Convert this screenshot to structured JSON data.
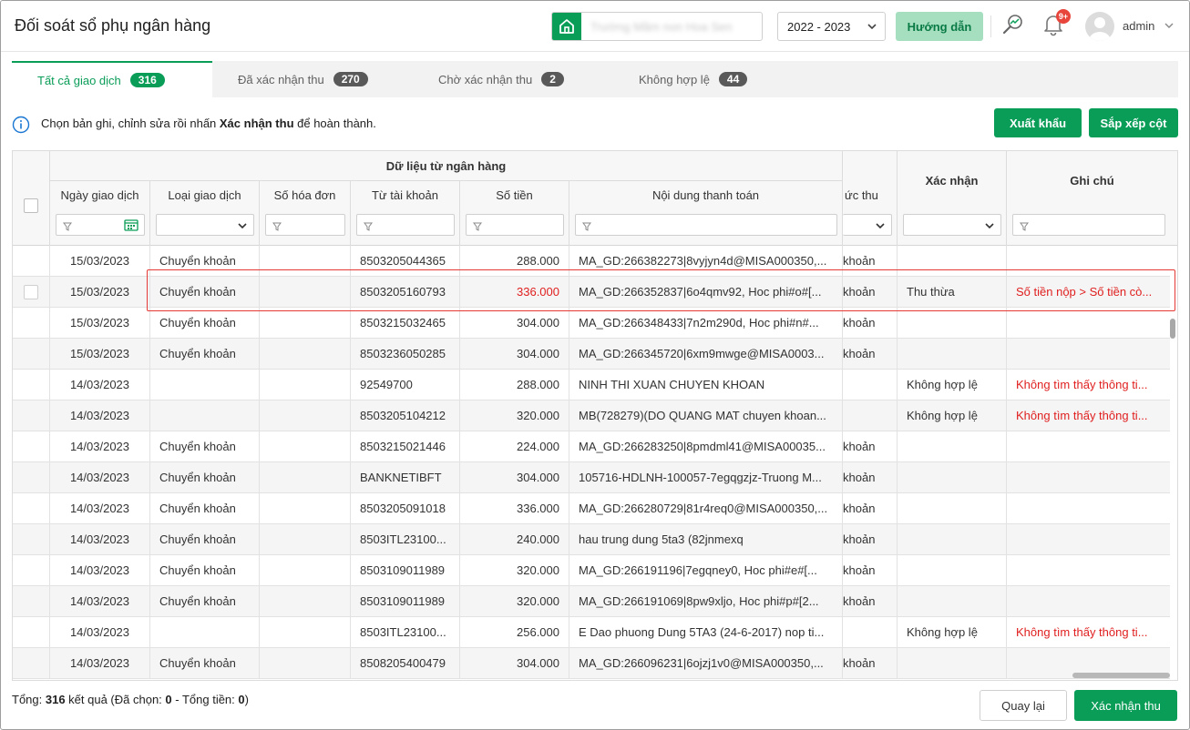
{
  "header": {
    "title": "Đối soát sổ phụ ngân hàng",
    "school_name": "Trường Mầm non Hoa Sen",
    "year": "2022 - 2023",
    "guide_label": "Hướng dẫn",
    "notification_badge": "9+",
    "user_name": "admin"
  },
  "tabs": [
    {
      "label": "Tất cả giao dịch",
      "count": "316"
    },
    {
      "label": "Đã xác nhận thu",
      "count": "270"
    },
    {
      "label": "Chờ xác nhận thu",
      "count": "2"
    },
    {
      "label": "Không hợp lệ",
      "count": "44"
    }
  ],
  "info": {
    "prefix": "Chọn bản ghi, chỉnh sửa rồi nhấn ",
    "bold": "Xác nhận thu",
    "suffix": " để hoàn thành."
  },
  "toolbar": {
    "export_label": "Xuất khẩu",
    "sort_label": "Sắp xếp cột"
  },
  "grid": {
    "group_title": "Dữ liệu từ ngân hàng",
    "columns": {
      "date": "Ngày giao dịch",
      "type": "Loại giao dịch",
      "invoice": "Số hóa đơn",
      "account": "Từ tài khoản",
      "amount": "Số tiền",
      "content": "Nội dung thanh toán",
      "method": "ức thu",
      "confirm": "Xác nhận",
      "note": "Ghi chú"
    },
    "rows": [
      {
        "date": "15/03/2023",
        "type": "Chuyển khoản",
        "invoice": "",
        "account": "8503205044365",
        "amount": "288.000",
        "content": "MA_GD:266382273|8vyjyn4d@MISA000350,...",
        "method": "khoản",
        "confirm": "",
        "note": ""
      },
      {
        "date": "15/03/2023",
        "type": "Chuyển khoản",
        "invoice": "",
        "account": "8503205160793",
        "amount": "336.000",
        "amount_red": true,
        "content": "MA_GD:266352837|6o4qmv92, Hoc phi#o#[...",
        "method": "khoản",
        "confirm": "Thu thừa",
        "note": "Số tiền nộp > Số tiền cò..."
      },
      {
        "date": "15/03/2023",
        "type": "Chuyển khoản",
        "invoice": "",
        "account": "8503215032465",
        "amount": "304.000",
        "content": "MA_GD:266348433|7n2m290d, Hoc phi#n#...",
        "method": "khoản",
        "confirm": "",
        "note": ""
      },
      {
        "date": "15/03/2023",
        "type": "Chuyển khoản",
        "invoice": "",
        "account": "8503236050285",
        "amount": "304.000",
        "content": "MA_GD:266345720|6xm9mwge@MISA0003...",
        "method": "khoản",
        "confirm": "",
        "note": ""
      },
      {
        "date": "14/03/2023",
        "type": "",
        "invoice": "",
        "account": "92549700",
        "amount": "288.000",
        "content": "NINH THI XUAN CHUYEN KHOAN",
        "method": "",
        "confirm": "Không hợp lệ",
        "note": "Không tìm thấy thông ti..."
      },
      {
        "date": "14/03/2023",
        "type": "",
        "invoice": "",
        "account": "8503205104212",
        "amount": "320.000",
        "content": "MB(728279)(DO QUANG MAT chuyen khoan...",
        "method": "",
        "confirm": "Không hợp lệ",
        "note": "Không tìm thấy thông ti..."
      },
      {
        "date": "14/03/2023",
        "type": "Chuyển khoản",
        "invoice": "",
        "account": "8503215021446",
        "amount": "224.000",
        "content": "MA_GD:266283250|8pmdml41@MISA00035...",
        "method": "khoản",
        "confirm": "",
        "note": ""
      },
      {
        "date": "14/03/2023",
        "type": "Chuyển khoản",
        "invoice": "",
        "account": "BANKNETIBFT",
        "amount": "304.000",
        "content": "105716-HDLNH-100057-7egqgzjz-Truong M...",
        "method": "khoản",
        "confirm": "",
        "note": ""
      },
      {
        "date": "14/03/2023",
        "type": "Chuyển khoản",
        "invoice": "",
        "account": "8503205091018",
        "amount": "336.000",
        "content": "MA_GD:266280729|81r4req0@MISA000350,...",
        "method": "khoản",
        "confirm": "",
        "note": ""
      },
      {
        "date": "14/03/2023",
        "type": "Chuyển khoản",
        "invoice": "",
        "account": "8503ITL23100...",
        "amount": "240.000",
        "content": "hau trung dung 5ta3 (82jnmexq",
        "method": "khoản",
        "confirm": "",
        "note": ""
      },
      {
        "date": "14/03/2023",
        "type": "Chuyển khoản",
        "invoice": "",
        "account": "8503109011989",
        "amount": "320.000",
        "content": "MA_GD:266191196|7egqney0, Hoc phi#e#[...",
        "method": "khoản",
        "confirm": "",
        "note": ""
      },
      {
        "date": "14/03/2023",
        "type": "Chuyển khoản",
        "invoice": "",
        "account": "8503109011989",
        "amount": "320.000",
        "content": "MA_GD:266191069|8pw9xljo, Hoc phi#p#[2...",
        "method": "khoản",
        "confirm": "",
        "note": ""
      },
      {
        "date": "14/03/2023",
        "type": "",
        "invoice": "",
        "account": "8503ITL23100...",
        "amount": "256.000",
        "content": "E Dao phuong Dung 5TA3 (24-6-2017) nop ti...",
        "method": "",
        "confirm": "Không hợp lệ",
        "note": "Không tìm thấy thông ti..."
      },
      {
        "date": "14/03/2023",
        "type": "Chuyển khoản",
        "invoice": "",
        "account": "8508205400479",
        "amount": "304.000",
        "content": "MA_GD:266096231|6ojzj1v0@MISA000350,...",
        "method": "khoản",
        "confirm": "",
        "note": ""
      }
    ]
  },
  "footer": {
    "total_label": "Tổng: ",
    "total_count": "316",
    "mid_label": " kết quả (Đã chọn: ",
    "selected_count": "0",
    "sum_label": " - Tổng tiền: ",
    "sum_value": "0",
    "close_paren": ")",
    "back_label": "Quay lại",
    "confirm_label": "Xác nhận thu"
  },
  "colors": {
    "accent": "#0a9d58",
    "error": "#e02020",
    "badge": "#e8453c"
  }
}
